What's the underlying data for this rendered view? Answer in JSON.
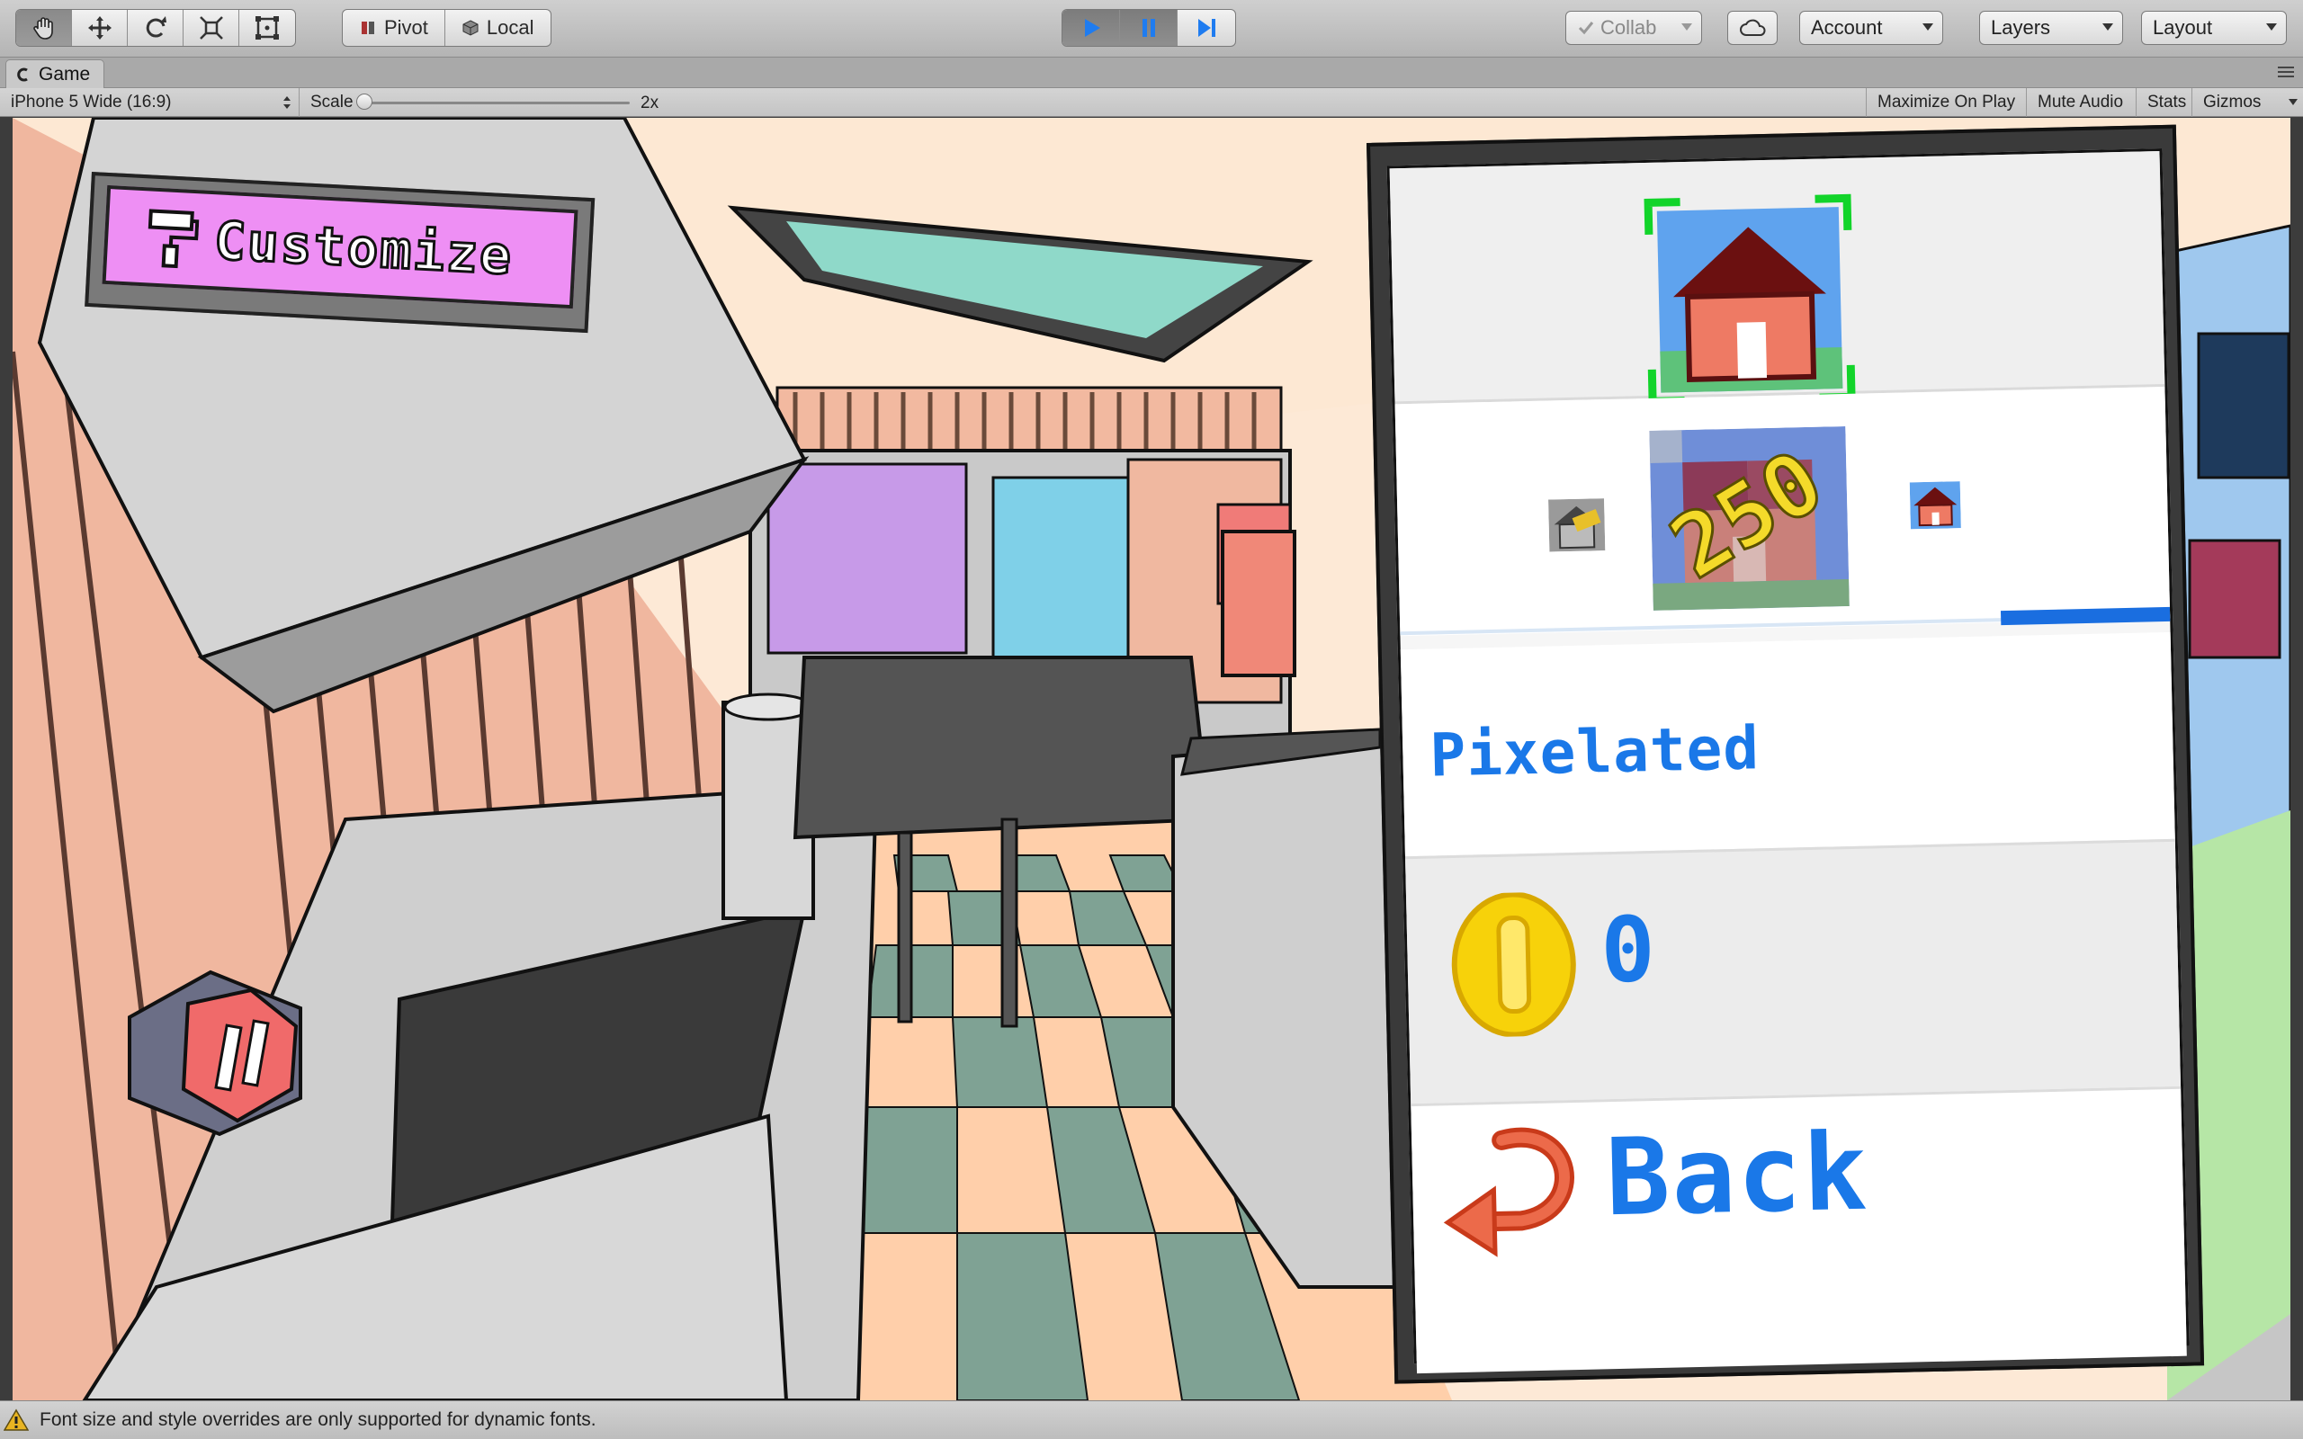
{
  "toolbar": {
    "pivot_label": "Pivot",
    "local_label": "Local",
    "collab_label": "Collab",
    "account_label": "Account",
    "layers_label": "Layers",
    "layout_label": "Layout",
    "tools": [
      "hand-tool",
      "move-tool",
      "rotate-tool",
      "scale-tool",
      "rect-tool"
    ]
  },
  "game_view": {
    "tab_label": "Game",
    "resolution": "iPhone 5 Wide (16:9)",
    "scale_label": "Scale",
    "scale_value": "2x",
    "scale_fraction": 0,
    "maximize_label": "Maximize On Play",
    "mute_label": "Mute Audio",
    "stats_label": "Stats",
    "gizmos_label": "Gizmos"
  },
  "scene": {
    "customize_label": "Customize"
  },
  "panel": {
    "mode_label": "Pixelated",
    "coins": "0",
    "back_label": "Back",
    "price_label": "250",
    "progress_fraction": 0.22,
    "accent_color": "#1a78e8"
  },
  "status": {
    "message": "Font size and style overrides are only supported for dynamic fonts."
  }
}
